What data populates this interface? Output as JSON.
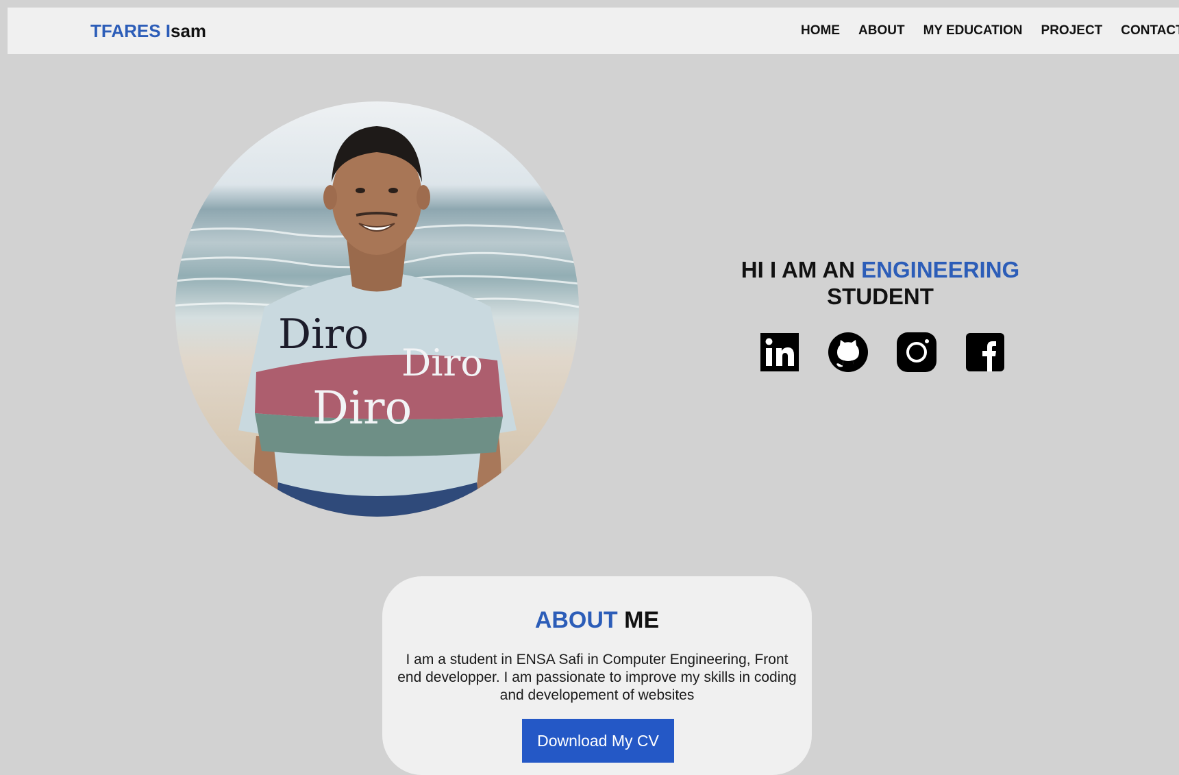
{
  "header": {
    "logo_first": "TFARES I",
    "logo_rest": "sam"
  },
  "nav": {
    "items": [
      {
        "label": "HOME"
      },
      {
        "label": "ABOUT"
      },
      {
        "label": "MY EDUCATION"
      },
      {
        "label": "PROJECT"
      },
      {
        "label": "CONTACT"
      }
    ]
  },
  "hero": {
    "title_part1": "HI I AM AN ",
    "title_accent": "ENGINEERING",
    "title_part2": "STUDENT",
    "photo_shirt_text": [
      "Diro",
      "Diro",
      "Diro"
    ],
    "socials": [
      {
        "icon": "linkedin-icon"
      },
      {
        "icon": "github-icon"
      },
      {
        "icon": "instagram-icon"
      },
      {
        "icon": "facebook-icon"
      }
    ]
  },
  "about": {
    "title_accent": "ABOUT",
    "title_rest": " ME",
    "text": "I am a student in ENSA Safi in Computer Engineering, Front end developper. I am passionate to improve my skills in coding and developement of websites",
    "button_label": "Download My CV"
  },
  "colors": {
    "accent": "#2c5db8",
    "button": "#2458c6",
    "page_background": "#d2d2d2",
    "card_background": "#f0f0f0"
  }
}
